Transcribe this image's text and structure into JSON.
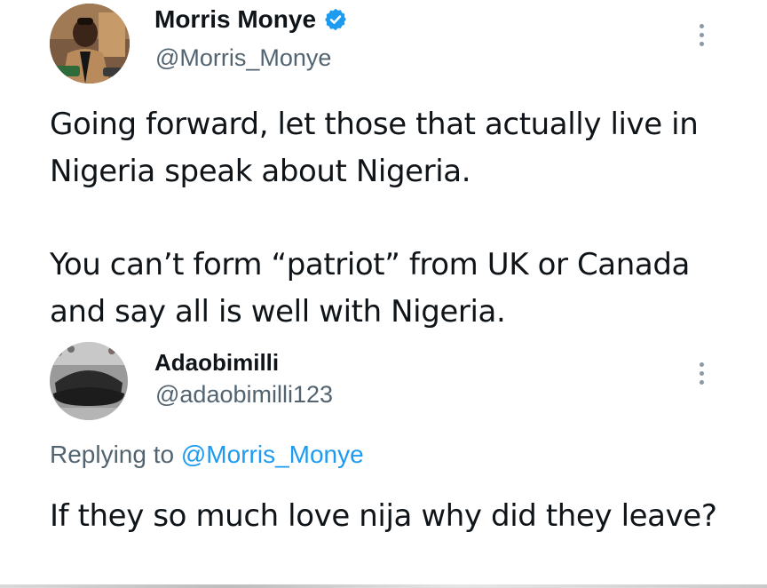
{
  "main_post": {
    "display_name": "Morris Monye",
    "handle": "@Morris_Monye",
    "verified": true,
    "paragraphs": [
      "Going forward, let those that actually live in Nigeria speak about Nigeria.",
      "You can’t form “patriot” from UK or Canada and say all is well with Nigeria."
    ],
    "icons": {
      "verified": "verified-badge-icon",
      "more": "more-options-icon"
    },
    "colors": {
      "verified": "#1d9bf0"
    }
  },
  "reply_post": {
    "display_name": "Adaobimilli",
    "handle": "@adaobimilli123",
    "replying_prefix": "Replying to ",
    "replying_mention": "@Morris_Monye",
    "text": "If they so much love nija why did they leave?",
    "icons": {
      "more": "more-options-icon"
    },
    "colors": {
      "mention": "#1d9bf0",
      "secondary_text": "#536471"
    }
  }
}
